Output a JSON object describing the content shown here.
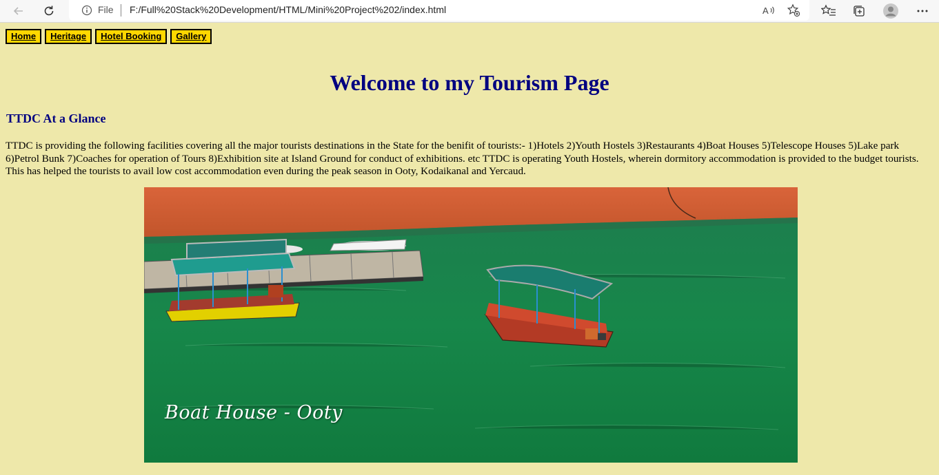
{
  "browser": {
    "file_label": "File",
    "url": "F:/Full%20Stack%20Development/HTML/Mini%20Project%202/index.html"
  },
  "menu": [
    {
      "label": "Home"
    },
    {
      "label": "Heritage"
    },
    {
      "label": "Hotel Booking"
    },
    {
      "label": "Gallery"
    }
  ],
  "page": {
    "title": "Welcome to my Tourism Page",
    "subtitle": "TTDC At a Glance",
    "description": "TTDC is providing the following facilities covering all the major tourists destinations in the State for the benifit of tourists:- 1)Hotels 2)Youth Hostels 3)Restaurants 4)Boat Houses 5)Telescope Houses 5)Lake park 6)Petrol Bunk 7)Coaches for operation of Tours 8)Exhibition site at Island Ground for conduct of exhibitions. etc TTDC is operating Youth Hostels, wherein dormitory accommodation is provided to the budget tourists. This has helped the tourists to avail low cost accommodation even during the peak season in Ooty, Kodaikanal and Yercaud.",
    "image_caption": "Boat House -  Ooty"
  }
}
